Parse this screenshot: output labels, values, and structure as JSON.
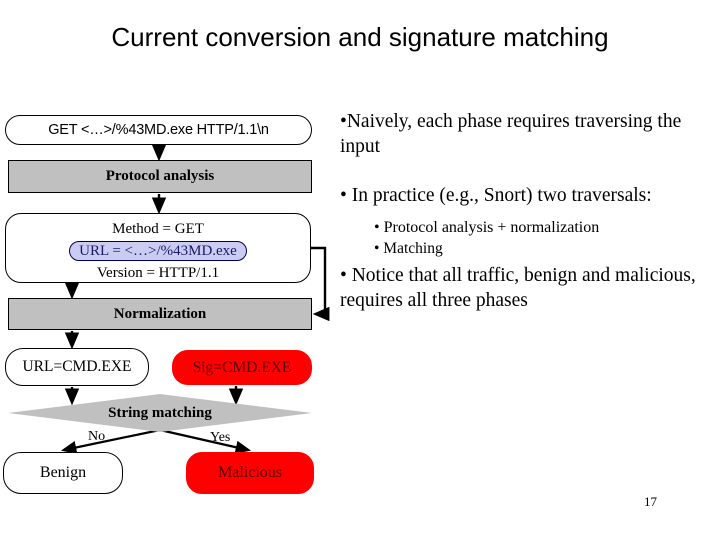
{
  "slide": {
    "title": "Current conversion and signature matching",
    "page_number": "17"
  },
  "flow": {
    "request_node": "GET  <…>/%43MD.exe  HTTP/1.1\\n",
    "protocol_analysis": "Protocol analysis",
    "parsed_fields": {
      "method": "Method = GET",
      "url": "URL = <…>/%43MD.exe",
      "version": "Version = HTTP/1.1"
    },
    "normalization": "Normalization",
    "url_normalized": "URL=CMD.EXE",
    "signature": "Sig=CMD.EXE",
    "string_matching": "String matching",
    "branch_no": "No",
    "branch_yes": "Yes",
    "benign": "Benign",
    "malicious": "Malicious"
  },
  "notes": {
    "bullet1": "•Naively, each phase requires traversing the input",
    "bullet2": "• In practice (e.g., Snort) two traversals:",
    "sub_bullet1": "• Protocol analysis + normalization",
    "sub_bullet2": "• Matching",
    "bullet3": "• Notice that all traffic, benign and malicious, requires all three phases"
  },
  "colors": {
    "gray_fill": "#C0C0C0",
    "red_fill": "#FF0000",
    "red_text": "#4D0000",
    "url_highlight_fill": "#CCCCF2",
    "url_highlight_text": "#1A1A66",
    "background": "#FFFFFF",
    "outline": "#000000"
  }
}
